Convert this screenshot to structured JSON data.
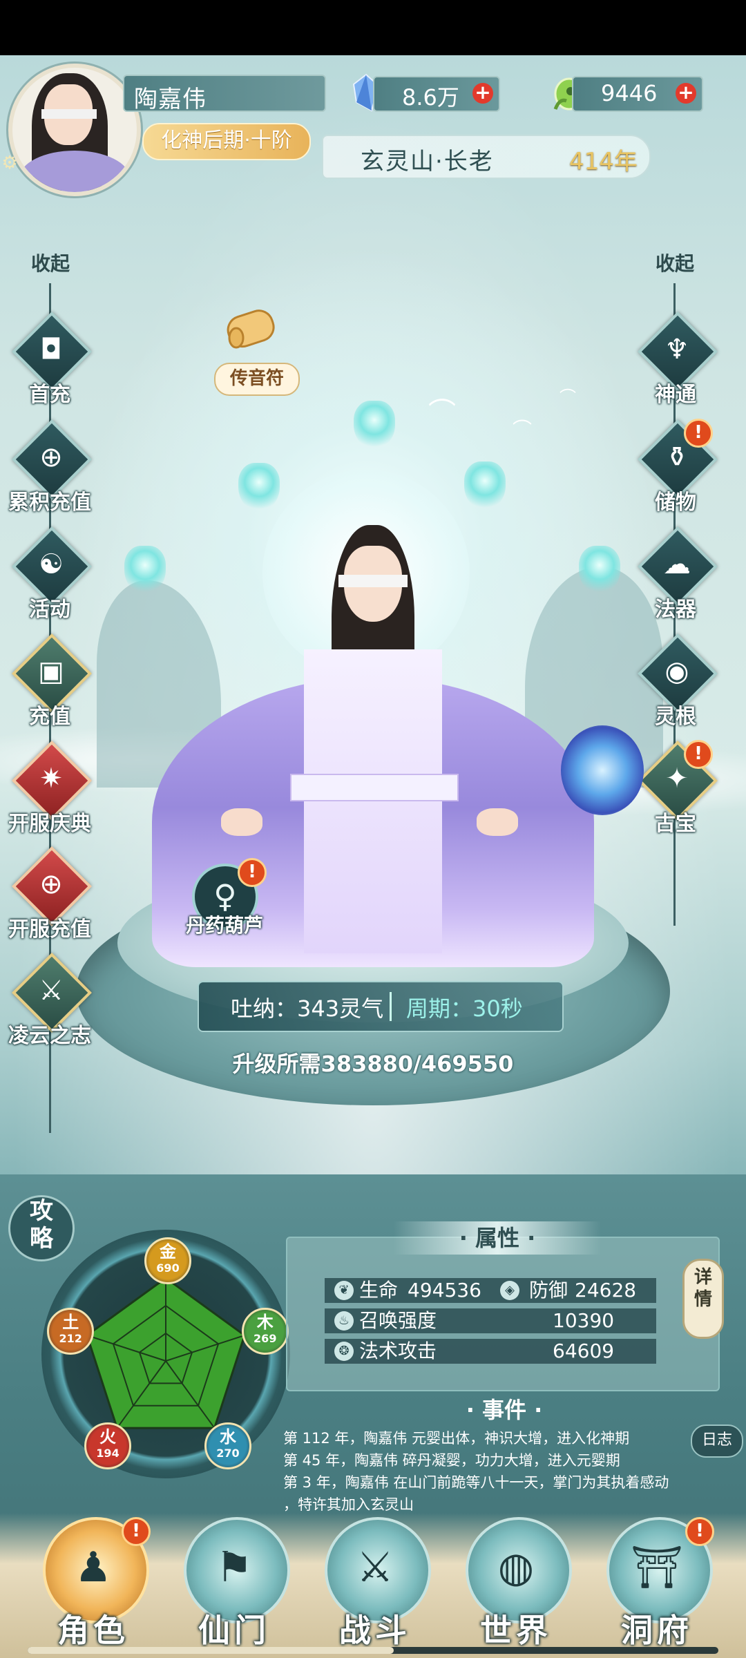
{
  "header": {
    "player_name": "陶嘉伟",
    "realm": "化神后期·十阶",
    "spirit_stones": "8.6万",
    "jade": "9446",
    "sect_position": "玄灵山·长老",
    "age": "414年"
  },
  "left_menu": {
    "collapse_label": "收起",
    "items": [
      {
        "label": "首充",
        "icon": "coin-icon"
      },
      {
        "label": "累积充值",
        "icon": "coin-plus-icon"
      },
      {
        "label": "活动",
        "icon": "taiji-icon"
      },
      {
        "label": "充值",
        "icon": "gift-icon"
      },
      {
        "label": "开服庆典",
        "icon": "celebration-icon"
      },
      {
        "label": "开服充值",
        "icon": "red-packet-icon"
      },
      {
        "label": "凌云之志",
        "icon": "sword-emblem-icon"
      }
    ]
  },
  "right_menu": {
    "collapse_label": "收起",
    "items": [
      {
        "label": "神通",
        "icon": "spirit-mark-icon",
        "alert": false
      },
      {
        "label": "储物",
        "icon": "storage-pot-icon",
        "alert": true
      },
      {
        "label": "法器",
        "icon": "cloud-artifact-icon",
        "alert": false
      },
      {
        "label": "灵根",
        "icon": "spirit-root-icon",
        "alert": false
      },
      {
        "label": "古宝",
        "icon": "ancient-treasure-icon",
        "alert": true
      }
    ]
  },
  "scroll_item": {
    "label": "传音符"
  },
  "gourd": {
    "label": "丹药葫芦"
  },
  "cultivation": {
    "breath_text": "吐纳：343灵气",
    "period_text": "周期：30秒",
    "upgrade_text": "升级所需383880/469550"
  },
  "strategy_button": {
    "chars": [
      "攻",
      "略"
    ]
  },
  "elements": [
    {
      "char": "金",
      "value": "690",
      "color": "#d59a1e"
    },
    {
      "char": "木",
      "value": "269",
      "color": "#4aa040"
    },
    {
      "char": "水",
      "value": "270",
      "color": "#2f8fb0"
    },
    {
      "char": "火",
      "value": "194",
      "color": "#c8372c"
    },
    {
      "char": "土",
      "value": "212",
      "color": "#c76a24"
    }
  ],
  "attributes": {
    "title": "· 属性 ·",
    "life_label": "生命",
    "life_value": "494536",
    "defense_label": "防御",
    "defense_value": "24628",
    "summon_label": "召唤强度",
    "summon_value": "10390",
    "spell_label": "法术攻击",
    "spell_value": "64609",
    "detail_chars": [
      "详",
      "情"
    ]
  },
  "events": {
    "title": "· 事件 ·",
    "lines": [
      "第 112 年，陶嘉伟 元婴出体，神识大增，进入化神期",
      "第 45 年，陶嘉伟 碎丹凝婴，功力大增，进入元婴期",
      "第 3 年，陶嘉伟 在山门前跪等八十一天，掌门为其执着感动",
      "，特许其加入玄灵山"
    ],
    "log_label": "日志"
  },
  "bottom_nav": [
    {
      "label": "角色",
      "icon": "character-icon",
      "active": true,
      "alert": true
    },
    {
      "label": "仙门",
      "icon": "sect-banner-icon",
      "active": false,
      "alert": false
    },
    {
      "label": "战斗",
      "icon": "sword-icon",
      "active": false,
      "alert": false
    },
    {
      "label": "世界",
      "icon": "world-icon",
      "active": false,
      "alert": false
    },
    {
      "label": "洞府",
      "icon": "cave-dwelling-icon",
      "active": false,
      "alert": true
    }
  ],
  "loading_progress": 0.53
}
